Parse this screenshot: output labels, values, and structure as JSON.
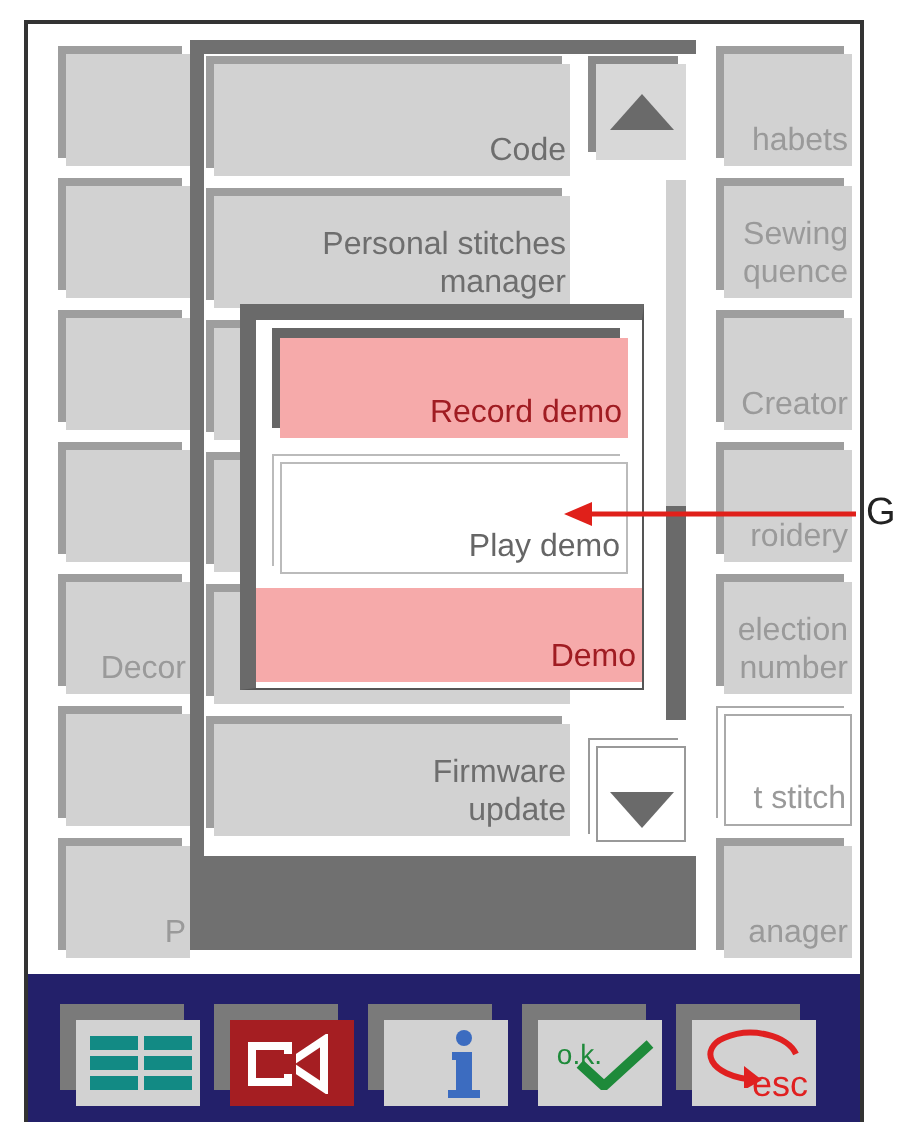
{
  "background_buttons": {
    "left": [
      {
        "kind": "blank"
      },
      {
        "kind": "blank"
      },
      {
        "kind": "blank"
      },
      {
        "kind": "blank"
      },
      {
        "kind": "labeled",
        "label": "Decor"
      },
      {
        "kind": "blank"
      },
      {
        "kind": "labeled",
        "label": "P"
      }
    ],
    "right": [
      {
        "label": "habets",
        "selected": false
      },
      {
        "label": "Sewing\nquence",
        "selected": false
      },
      {
        "label": "Creator",
        "selected": false
      },
      {
        "label": "roidery",
        "selected": false
      },
      {
        "label": "election\nnumber",
        "selected": false
      },
      {
        "label": "t stitch",
        "selected": true
      },
      {
        "label": "anager",
        "selected": false
      }
    ]
  },
  "menu": {
    "items": [
      {
        "kind": "labeled",
        "label": "Code"
      },
      {
        "kind": "labeled",
        "label": "Personal stitches\nmanager"
      },
      {
        "kind": "blank"
      },
      {
        "kind": "blank"
      },
      {
        "kind": "blank"
      },
      {
        "kind": "labeled",
        "label": "Firmware\nupdate"
      }
    ]
  },
  "demo_popup": {
    "items": [
      {
        "label": "Record demo",
        "highlighted": true
      },
      {
        "label": "Play demo",
        "highlighted": false
      },
      {
        "label": "Demo",
        "highlighted": true
      }
    ]
  },
  "toolbar": [
    {
      "kind": "list"
    },
    {
      "kind": "exit"
    },
    {
      "kind": "info"
    },
    {
      "kind": "ok",
      "text": "o.k."
    },
    {
      "kind": "esc",
      "text": "esc"
    }
  ],
  "annotation": {
    "label": "G"
  }
}
